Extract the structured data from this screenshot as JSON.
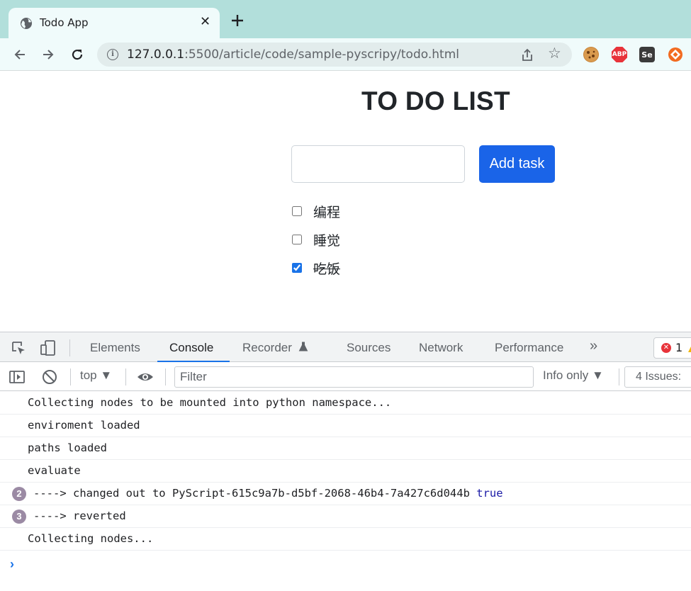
{
  "browser": {
    "tab_title": "Todo App",
    "new_tab_icon": "plus-icon",
    "url_host": "127.0.0.1",
    "url_path": ":5500/article/code/sample-pyscripy/todo.html",
    "extensions": [
      {
        "name": "cookie-extension-icon",
        "label": "",
        "color": "#c8843a"
      },
      {
        "name": "adblock-plus-icon",
        "label": "ABP",
        "color": "#e8333a"
      },
      {
        "name": "selenium-ide-icon",
        "label": "Se",
        "color": "#3b3b3b"
      },
      {
        "name": "orange-extension-icon",
        "label": "",
        "color": "#f26b21"
      }
    ]
  },
  "page": {
    "title": "TO DO LIST",
    "input_value": "",
    "add_button": "Add task",
    "todos": [
      {
        "text": "编程",
        "done": false
      },
      {
        "text": "睡觉",
        "done": false
      },
      {
        "text": "吃饭",
        "done": true
      }
    ],
    "accent_color": "#1a64e8"
  },
  "devtools": {
    "tabs": [
      "Elements",
      "Console",
      "Recorder",
      "Sources",
      "Network",
      "Performance"
    ],
    "active_tab": "Console",
    "more_tabs": "»",
    "error_count": "1",
    "context": "top",
    "filter_placeholder": "Filter",
    "levels": "Info only",
    "issues": "4 Issues:",
    "logs": [
      {
        "count": "",
        "text": "Collecting nodes to be mounted into python namespace..."
      },
      {
        "count": "",
        "text": "enviroment loaded"
      },
      {
        "count": "",
        "text": "paths loaded"
      },
      {
        "count": "",
        "text": "evaluate"
      },
      {
        "count": "2",
        "text": "----> changed out to PyScript-615c9a7b-d5bf-2068-46b4-7a427c6d044b",
        "suffix": "true"
      },
      {
        "count": "3",
        "text": "----> reverted"
      },
      {
        "count": "",
        "text": "Collecting nodes..."
      }
    ],
    "prompt": "›"
  }
}
